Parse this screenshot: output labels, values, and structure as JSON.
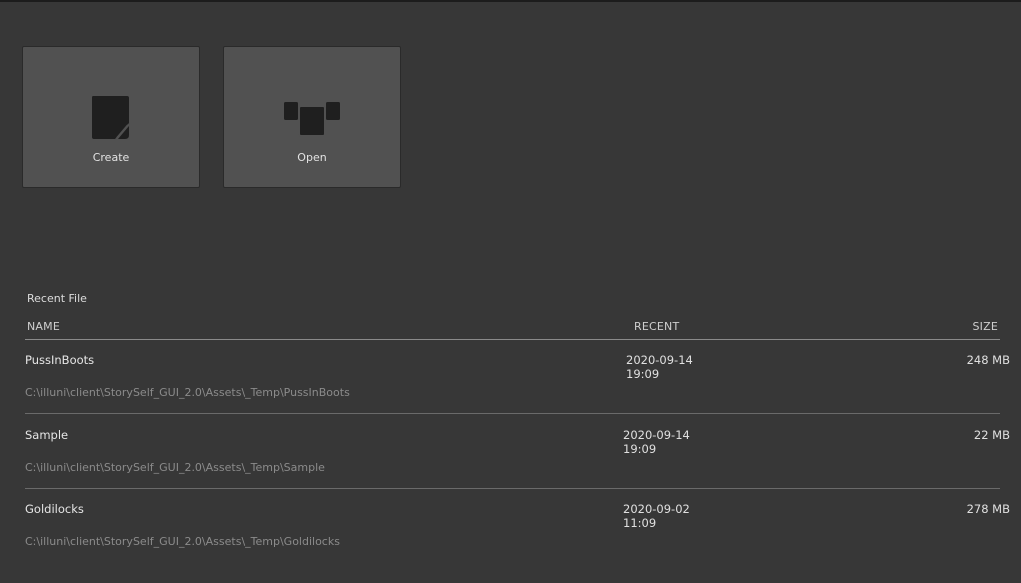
{
  "actions": {
    "create_label": "Create",
    "open_label": "Open"
  },
  "recent": {
    "title": "Recent File",
    "columns": {
      "name": "NAME",
      "recent": "RECENT",
      "size": "SIZE"
    },
    "files": [
      {
        "name": "PussInBoots",
        "path": "C:\\illuni\\client\\StorySelf_GUI_2.0\\Assets\\_Temp\\PussInBoots",
        "date": "2020-09-14",
        "time": "19:09",
        "size": "248 MB"
      },
      {
        "name": "Sample",
        "path": "C:\\illuni\\client\\StorySelf_GUI_2.0\\Assets\\_Temp\\Sample",
        "date": "2020-09-14",
        "time": "19:09",
        "size": "22 MB"
      },
      {
        "name": "Goldilocks",
        "path": "C:\\illuni\\client\\StorySelf_GUI_2.0\\Assets\\_Temp\\Goldilocks",
        "date": "2020-09-02",
        "time": "11:09",
        "size": "278 MB"
      }
    ]
  },
  "icons": {
    "create": "new-file-icon",
    "open": "open-files-icon"
  },
  "colors": {
    "background": "#373737",
    "tile": "#515151",
    "icon": "#1f1f1f"
  }
}
